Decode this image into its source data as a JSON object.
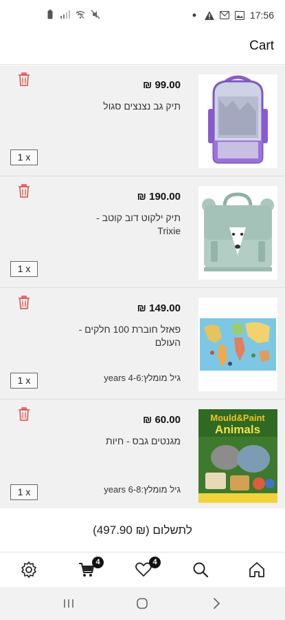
{
  "status_bar": {
    "time": "17:56",
    "left_icons": [
      "battery-icon",
      "signal-icon",
      "wifi-off-icon",
      "mute-icon"
    ],
    "right_icons": [
      "dot-icon",
      "alert-icon",
      "voicemail-icon",
      "image-icon"
    ]
  },
  "header": {
    "title": "Cart"
  },
  "cart": {
    "items": [
      {
        "price": "99.00 ₪",
        "name": "תיק גב נצנצים סגול",
        "age": "",
        "quantity": "1 x"
      },
      {
        "price": "190.00 ₪",
        "name": "תיק ילקוט דוב קוטב - Trixie",
        "age": "",
        "quantity": "1 x"
      },
      {
        "price": "149.00 ₪",
        "name": "פאזל חוברת 100 חלקים - העולם",
        "age": "גיל מומלץ:4-6 years",
        "quantity": "1 x"
      },
      {
        "price": "60.00 ₪",
        "name": "מגנטים גבס - חיות",
        "age": "גיל מומלץ:6-8 years",
        "quantity": "1 x"
      }
    ],
    "image_4_text": {
      "line1": "Mould&Paint",
      "line2": "Animals"
    }
  },
  "total": {
    "label": "לתשלום (₪ 497.90)"
  },
  "bottom_nav": {
    "items": [
      {
        "icon": "settings-icon"
      },
      {
        "icon": "cart-icon",
        "badge": "4"
      },
      {
        "icon": "heart-icon",
        "badge": "4"
      },
      {
        "icon": "search-icon"
      },
      {
        "icon": "home-icon"
      }
    ]
  },
  "colors": {
    "trash": "#e0483f",
    "accent": "#111111",
    "list_bg": "#f1f1f1"
  }
}
